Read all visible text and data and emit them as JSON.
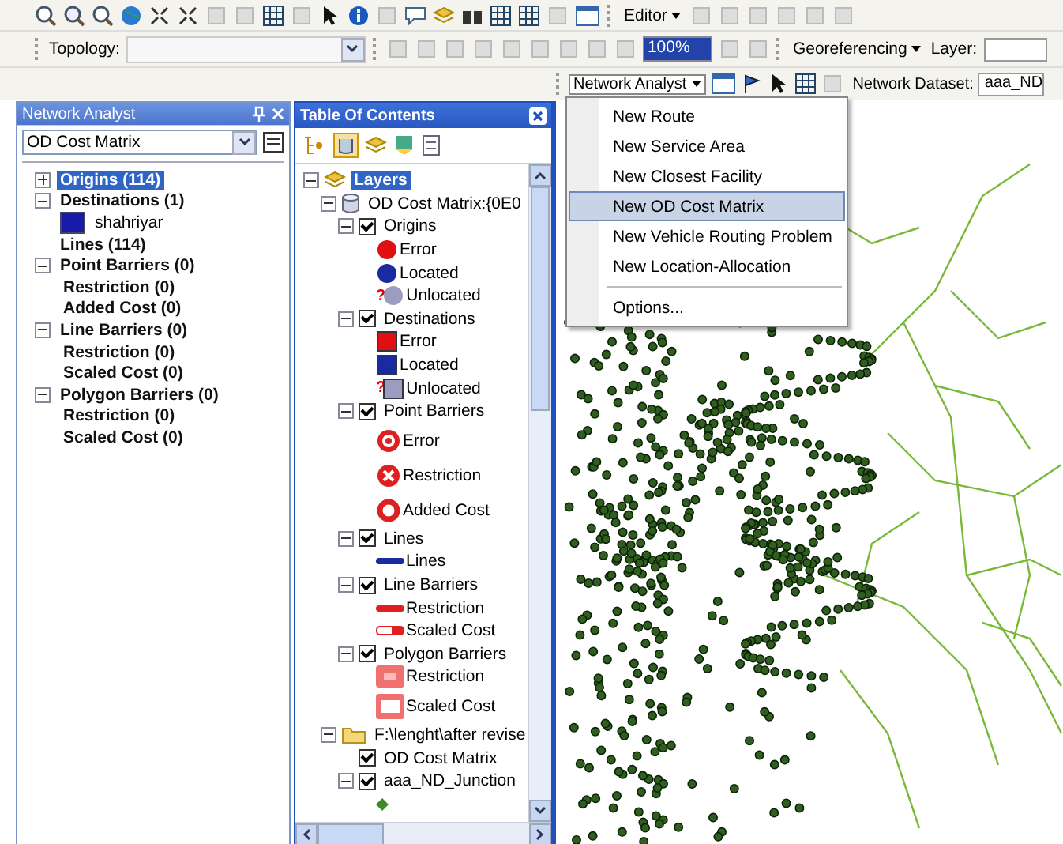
{
  "toolbar": {
    "editor_menu": "Editor",
    "topology_label": "Topology:",
    "zoom_value": "100%",
    "georeferencing_menu": "Georeferencing",
    "layer_label": "Layer:",
    "network_analyst_menu": "Network Analyst",
    "network_dataset_label": "Network Dataset:",
    "network_dataset_value": "aaa_ND"
  },
  "network_analyst": {
    "title": "Network Analyst",
    "problem": "OD Cost Matrix",
    "items": [
      {
        "label": "Origins (114)",
        "kind": "class",
        "expanded": false,
        "selected": true
      },
      {
        "label": "Destinations (1)",
        "kind": "class",
        "expanded": true,
        "selected": false,
        "children": [
          {
            "label": "shahriyar",
            "kind": "object",
            "color": "#1a1aa8",
            "selected": false
          }
        ]
      },
      {
        "label": "Lines (114)",
        "kind": "class",
        "selected": false
      },
      {
        "label": "Point Barriers (0)",
        "kind": "class",
        "expanded": true,
        "selected": false,
        "children": [
          {
            "label": "Restriction (0)",
            "kind": "class",
            "selected": false
          },
          {
            "label": "Added Cost (0)",
            "kind": "class",
            "selected": false
          }
        ]
      },
      {
        "label": "Line Barriers (0)",
        "kind": "class",
        "expanded": true,
        "selected": false,
        "children": [
          {
            "label": "Restriction (0)",
            "kind": "class",
            "selected": false
          },
          {
            "label": "Scaled Cost (0)",
            "kind": "class",
            "selected": false
          }
        ]
      },
      {
        "label": "Polygon Barriers (0)",
        "kind": "class",
        "expanded": true,
        "selected": false,
        "children": [
          {
            "label": "Restriction (0)",
            "kind": "class",
            "selected": false
          },
          {
            "label": "Scaled Cost (0)",
            "kind": "class",
            "selected": false
          }
        ]
      }
    ]
  },
  "table_of_contents": {
    "title": "Table Of Contents",
    "nodes": [
      {
        "label": "Layers",
        "kind": "layers",
        "expanded": true,
        "selected": true,
        "children": [
          {
            "label": "OD Cost Matrix:{0E0",
            "kind": "dataset",
            "expanded": true,
            "selected": false,
            "children": [
              {
                "label": "Origins",
                "kind": "layer",
                "expanded": true,
                "checked": true,
                "selected": false,
                "children": [
                  {
                    "label": "Error",
                    "kind": "circle",
                    "color": "#e01010"
                  },
                  {
                    "label": "Located",
                    "kind": "circle",
                    "color": "#1a2aa0"
                  },
                  {
                    "label": "Unlocated",
                    "kind": "circle",
                    "color": "#9a9cc0",
                    "flag": "?"
                  }
                ]
              },
              {
                "label": "Destinations",
                "kind": "layer",
                "expanded": true,
                "checked": true,
                "selected": false,
                "children": [
                  {
                    "label": "Error",
                    "kind": "square",
                    "color": "#e01010"
                  },
                  {
                    "label": "Located",
                    "kind": "square",
                    "color": "#1a2aa0"
                  },
                  {
                    "label": "Unlocated",
                    "kind": "square",
                    "color": "#9a9cc0",
                    "flag": "?"
                  }
                ]
              },
              {
                "label": "Point Barriers",
                "kind": "layer",
                "expanded": true,
                "checked": true,
                "selected": false,
                "children": [
                  {
                    "label": "Error",
                    "kind": "badge",
                    "color": "#e02020"
                  },
                  {
                    "label": "Restriction",
                    "kind": "cross",
                    "color": "#e02020"
                  },
                  {
                    "label": "Added Cost",
                    "kind": "ring",
                    "color": "#e02020"
                  }
                ]
              },
              {
                "label": "Lines",
                "kind": "layer",
                "expanded": true,
                "checked": true,
                "selected": false,
                "children": [
                  {
                    "label": "Lines",
                    "kind": "line",
                    "color": "#1a2aa0"
                  }
                ]
              },
              {
                "label": "Line Barriers",
                "kind": "layer",
                "expanded": true,
                "checked": true,
                "selected": false,
                "children": [
                  {
                    "label": "Restriction",
                    "kind": "line",
                    "color": "#e02020"
                  },
                  {
                    "label": "Scaled Cost",
                    "kind": "line-outline",
                    "color": "#e02020"
                  }
                ]
              },
              {
                "label": "Polygon Barriers",
                "kind": "layer",
                "expanded": true,
                "checked": true,
                "selected": false,
                "children": [
                  {
                    "label": "Restriction",
                    "kind": "polygon",
                    "color": "#f07070"
                  },
                  {
                    "label": "Scaled Cost",
                    "kind": "polygon-outline",
                    "color": "#f07070"
                  }
                ]
              }
            ]
          },
          {
            "label": "F:\\lenght\\after revise",
            "kind": "folder",
            "expanded": true,
            "selected": false,
            "children": [
              {
                "label": "OD Cost Matrix",
                "kind": "layer",
                "checked": true,
                "selected": false
              },
              {
                "label": "aaa_ND_Junction",
                "kind": "layer",
                "expanded": true,
                "checked": true,
                "selected": false,
                "children": [
                  {
                    "kind": "point",
                    "color": "#3c8a2a"
                  }
                ]
              }
            ]
          }
        ]
      }
    ]
  },
  "network_menu": {
    "items": [
      {
        "label": "New Route",
        "kind": "item",
        "selected": false
      },
      {
        "label": "New Service Area",
        "kind": "item",
        "selected": false
      },
      {
        "label": "New Closest Facility",
        "kind": "item",
        "selected": false
      },
      {
        "label": "New OD Cost Matrix",
        "kind": "item",
        "selected": true
      },
      {
        "label": "New Vehicle Routing Problem",
        "kind": "item",
        "selected": false
      },
      {
        "label": "New Location-Allocation",
        "kind": "item",
        "selected": false
      },
      {
        "kind": "separator"
      },
      {
        "label": "Options...",
        "kind": "item",
        "selected": false
      }
    ]
  }
}
